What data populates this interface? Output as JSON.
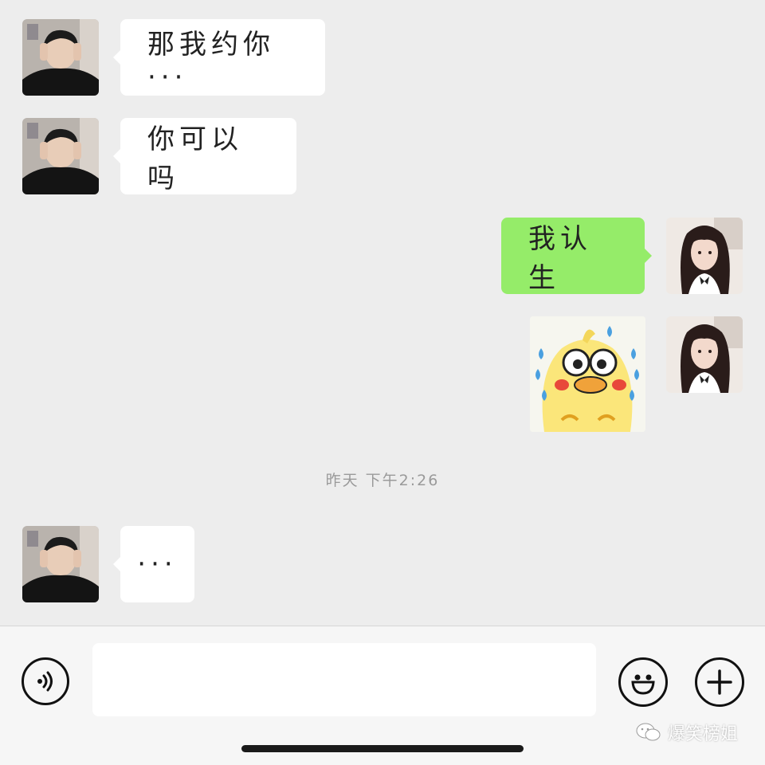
{
  "messages": [
    {
      "from": "contact",
      "text": "那我约你···"
    },
    {
      "from": "contact",
      "text": "你可以吗"
    },
    {
      "from": "me",
      "text": "我认生"
    },
    {
      "from": "me",
      "sticker": "crying-yellow-duck-sticker"
    }
  ],
  "timestamp": "昨天 下午2:26",
  "messages_after": [
    {
      "from": "contact",
      "text": "···"
    }
  ],
  "input_bar": {
    "voice_icon": "voice-icon",
    "input_value": "",
    "emoji_icon": "emoji-icon",
    "plus_icon": "plus-icon"
  },
  "watermark": {
    "text": "爆笑榜姐",
    "icon": "wechat-official-account-icon"
  },
  "colors": {
    "background": "#ededed",
    "incoming_bubble": "#ffffff",
    "outgoing_bubble": "#95ec69",
    "timestamp": "#9a9a9a"
  }
}
